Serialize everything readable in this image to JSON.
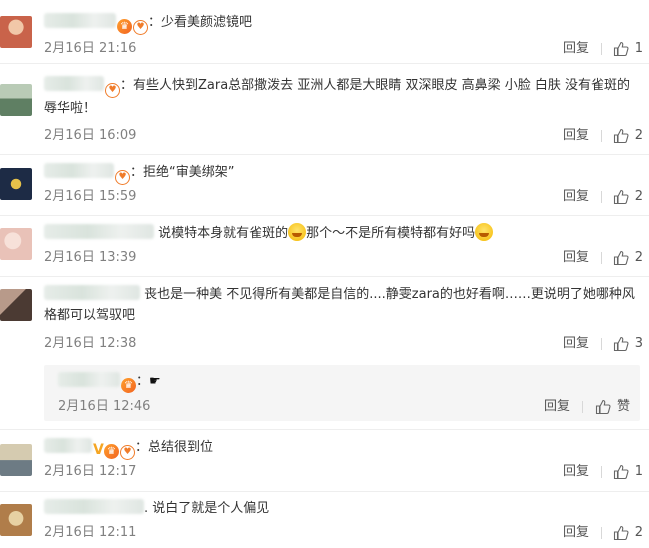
{
  "comments": [
    {
      "text": "：少看美颜滤镜吧",
      "date": "2月16日 21:16",
      "reply": "回复",
      "likes": "1",
      "avatar_colors": [
        "#c9634a",
        "#f1c7a8"
      ]
    },
    {
      "text": "：有些人快到Zara总部撒泼去  亚洲人都是大眼睛  双深眼皮  高鼻梁  小脸  白肤  没有雀斑的    辱华啦！",
      "date": "2月16日 16:09",
      "reply": "回复",
      "likes": "2",
      "avatar_colors": [
        "#5f7f63",
        "#b9cbb6"
      ]
    },
    {
      "text": "：拒绝“审美绑架”",
      "date": "2月16日 15:59",
      "reply": "回复",
      "likes": "2",
      "avatar_colors": [
        "#1d2b45",
        "#e6c14a"
      ]
    },
    {
      "text_a": "说模特本身就有雀斑的",
      "text_b": "那个～不是所有模特都有好吗",
      "date": "2月16日 13:39",
      "reply": "回复",
      "likes": "2",
      "avatar_colors": [
        "#e9c2b8",
        "#f7e1d9"
      ]
    },
    {
      "text": "丧也是一种美 不见得所有美都是自信的....静雯zara的也好看啊……更说明了她哪种风格都可以驾驭吧",
      "date": "2月16日 12:38",
      "reply": "回复",
      "likes": "3",
      "avatar_colors": [
        "#4b3a33",
        "#b89a8a"
      ]
    },
    {
      "text": "：总结很到位",
      "date": "2月16日 12:17",
      "reply": "回复",
      "likes": "1",
      "avatar_colors": [
        "#6d7b84",
        "#d5cbb0"
      ]
    },
    {
      "text": ". 说白了就是个人偏见",
      "date": "2月16日 12:11",
      "reply": "回复",
      "likes": "2",
      "avatar_colors": [
        "#e7d1a3",
        "#b07d4a"
      ]
    }
  ],
  "nested_reply": {
    "text": "：",
    "date": "2月16日 12:46",
    "reply": "回复",
    "likes": "赞"
  },
  "colors": {
    "separator": "#eeeeee",
    "meta_text": "#808080",
    "accent_orange": "#f07c2a"
  },
  "icons": [
    "thumbs-up-icon",
    "vip-badge-icon",
    "fan-badge-icon",
    "laughing-emoji-icon",
    "pointing-hand-icon"
  ]
}
